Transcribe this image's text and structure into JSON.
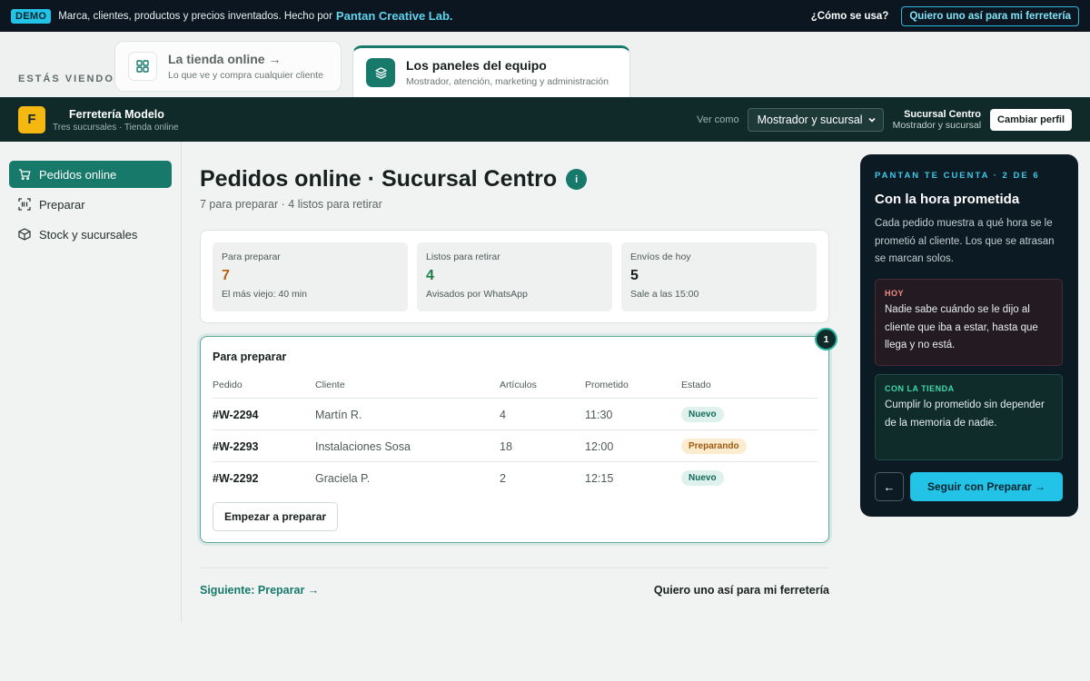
{
  "demo": {
    "badge": "DEMO",
    "text": "Marca, clientes, productos y precios inventados. Hecho por",
    "link": "Pantan Creative Lab.",
    "how": "¿Cómo se usa?",
    "cta": "Quiero uno así para mi ferretería"
  },
  "viewing": {
    "label": "ESTÁS VIENDO",
    "tabs": [
      {
        "title": "La tienda online →",
        "sub": "Lo que ve y compra cualquier cliente",
        "icon": "grid-icon"
      },
      {
        "title": "Los paneles del equipo",
        "sub": "Mostrador, atención, marketing y administración",
        "icon": "layers-icon"
      }
    ]
  },
  "header": {
    "logo_letter": "F",
    "brand": "Ferretería Modelo",
    "brand_sub": "Tres sucursales · Tienda online",
    "ver_como": "Ver como",
    "select_value": "Mostrador y sucursal",
    "branch_name": "Sucursal Centro",
    "branch_sub": "Mostrador y sucursal",
    "change_profile": "Cambiar perfil"
  },
  "sidebar": {
    "items": [
      {
        "label": "Pedidos online",
        "icon": "cart-icon",
        "active": true
      },
      {
        "label": "Preparar",
        "icon": "scan-icon",
        "active": false
      },
      {
        "label": "Stock y sucursales",
        "icon": "box-icon",
        "active": false
      }
    ]
  },
  "main": {
    "title": "Pedidos online · Sucursal Centro",
    "info": "i",
    "subtitle": "7 para preparar · 4 listos para retirar",
    "stats": [
      {
        "label": "Para preparar",
        "value": "7",
        "note": "El más viejo: 40 min",
        "color": "#b5620f"
      },
      {
        "label": "Listos para retirar",
        "value": "4",
        "note": "Avisados por WhatsApp",
        "color": "#1f7a4a"
      },
      {
        "label": "Envíos de hoy",
        "value": "5",
        "note": "Sale a las 15:00",
        "color": "#17201e"
      }
    ],
    "orders": {
      "step": "1",
      "title": "Para preparar",
      "headers": [
        "Pedido",
        "Cliente",
        "Artículos",
        "Prometido",
        "Estado"
      ],
      "rows": [
        {
          "id": "#W-2294",
          "client": "Martín R.",
          "items": "4",
          "promised": "11:30",
          "status": "Nuevo"
        },
        {
          "id": "#W-2293",
          "client": "Instalaciones Sosa",
          "items": "18",
          "promised": "12:00",
          "status": "Preparando"
        },
        {
          "id": "#W-2292",
          "client": "Graciela P.",
          "items": "2",
          "promised": "12:15",
          "status": "Nuevo"
        }
      ],
      "start_button": "Empezar a preparar"
    },
    "next_link": "Siguiente: Preparar →",
    "want_link": "Quiero uno así para mi ferretería"
  },
  "guide": {
    "eyebrow": "PANTAN TE CUENTA · 2 DE 6",
    "title": "Con la hora prometida",
    "text": "Cada pedido muestra a qué hora se le prometió al cliente. Los que se atrasan se marcan solos.",
    "today_label": "HOY",
    "today_text": "Nadie sabe cuándo se le dijo al cliente que iba a estar, hasta que llega y no está.",
    "with_label": "CON LA TIENDA",
    "with_text": "Cumplir lo prometido sin depender de la memoria de nadie.",
    "back": "←",
    "next": "Seguir con Preparar →"
  }
}
